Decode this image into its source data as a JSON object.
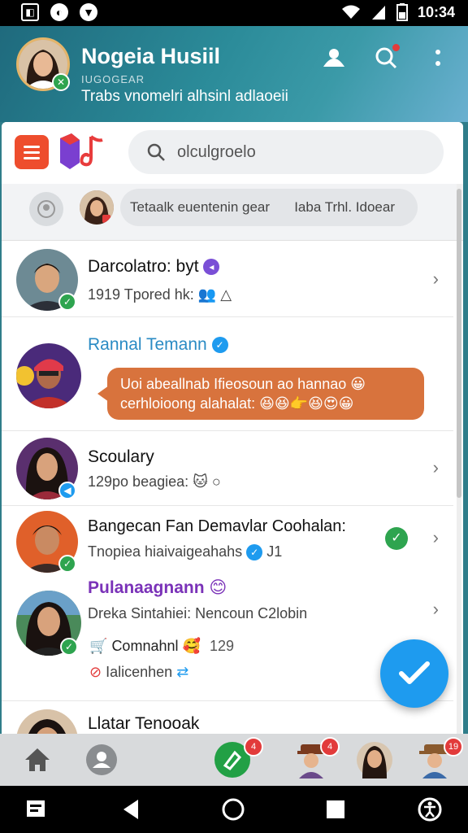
{
  "status_bar": {
    "time": "10:34"
  },
  "header": {
    "profile_name": "Nogeia Husiil",
    "sub_small": "IUGOGEAR",
    "subtitle": "Trabs vnomelri alhsinl adlaoeii"
  },
  "toolbar": {
    "search_placeholder": "olculgroelo"
  },
  "stories": {
    "label_left": "Tetaalk euentenin gear",
    "label_right": "Iaba Trhl. Idoear"
  },
  "chats": [
    {
      "name": "Darcolatro: byt",
      "message": "1919 Tpored hk:"
    },
    {
      "name": "Rannal Temann",
      "bubble_line1": "Uoi abeallnab Ifieosoun ao hannao",
      "bubble_line2": "cerhloioong alahalat:"
    },
    {
      "name": "Scoulary",
      "message": "129po beagiea:"
    },
    {
      "name": "Bangecan Fan Demavlar Coohalan:",
      "message": "Tnopiea hiaivaigeahahs",
      "extra": "J1"
    },
    {
      "name": "Pulanaagnann",
      "message": "Dreka Sintahiei: Nencoun C2lobin",
      "line3": "Comnahnl",
      "line3_count": "129",
      "line4": "Ialicenhen"
    },
    {
      "name": "Llatar Tenooak"
    }
  ],
  "bottom_nav": {
    "badges": [
      "4",
      "4",
      "19"
    ]
  },
  "colors": {
    "header": "#2b8b99",
    "accent": "#1e9bef",
    "menu": "#ee4d2d",
    "bubble": "#d8733d"
  }
}
